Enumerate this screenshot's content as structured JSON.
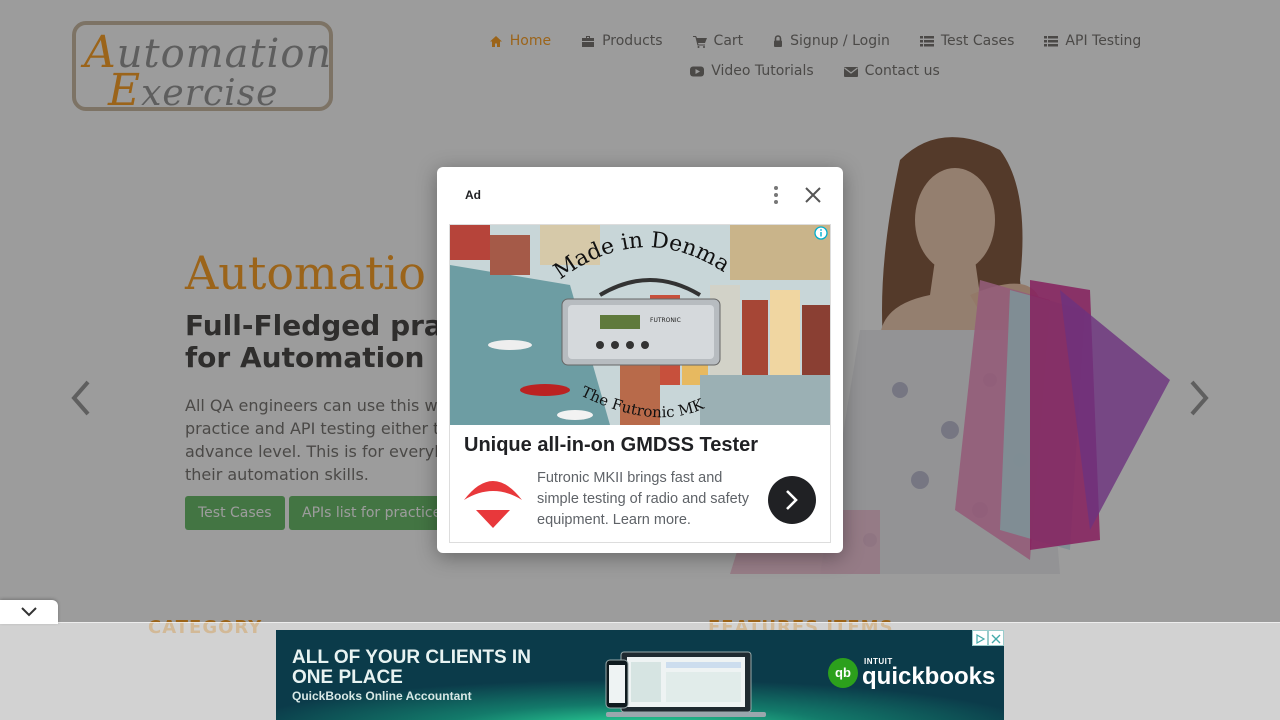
{
  "logo": {
    "line1_cap": "A",
    "line1_rest": "utomation",
    "line2_cap": "E",
    "line2_rest": "xercise"
  },
  "nav": {
    "items": [
      {
        "label": "Home",
        "icon": "home-icon",
        "active": true
      },
      {
        "label": "Products",
        "icon": "briefcase-icon"
      },
      {
        "label": "Cart",
        "icon": "cart-icon"
      },
      {
        "label": "Signup / Login",
        "icon": "lock-icon"
      },
      {
        "label": "Test Cases",
        "icon": "list-icon"
      },
      {
        "label": "API Testing",
        "icon": "list-icon"
      },
      {
        "label": "Video Tutorials",
        "icon": "youtube-icon"
      },
      {
        "label": "Contact us",
        "icon": "envelope-icon"
      }
    ]
  },
  "hero": {
    "title": "Automatio",
    "subtitle": "Full-Fledged pra for Automation",
    "text": "All QA engineers can use this w practice and API testing either t advance level. This is for everyl their automation skills.",
    "buttons": {
      "test_cases": "Test Cases",
      "apis_list": "APIs list for practice"
    }
  },
  "sections": {
    "category": "CATEGORY",
    "features": "FEATURES ITEMS"
  },
  "ad": {
    "label": "Ad",
    "image_text_top": "Made in Denmark",
    "image_text_bottom": "The Futronic MKII",
    "device_brand": "FUTRONIC",
    "headline": "Unique all-in-on GMDSS Tester",
    "body": "Futronic MKII brings fast and simple testing of radio and safety equipment. Learn more."
  },
  "banner": {
    "headline": "ALL OF YOUR CLIENTS IN ONE PLACE",
    "subline": "QuickBooks Online Accountant",
    "brand_mark": "qb",
    "brand_intuit": "INTUIT",
    "brand_name": "quickbooks"
  },
  "colors": {
    "accent": "#fe980f",
    "button": "#5cb85c",
    "overlay": "rgba(40,40,40,0.46)",
    "banner_bg": "#0b3b4a"
  }
}
